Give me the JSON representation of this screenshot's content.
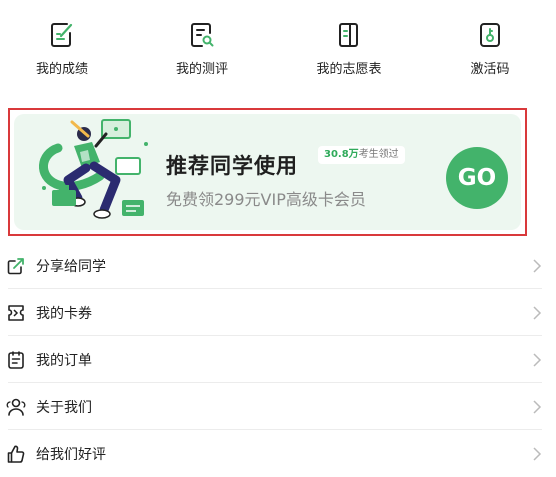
{
  "quick_links": [
    {
      "label": "我的成绩",
      "icon": "report-edit-icon"
    },
    {
      "label": "我的测评",
      "icon": "evaluation-search-icon"
    },
    {
      "label": "我的志愿表",
      "icon": "volunteer-form-icon"
    },
    {
      "label": "激活码",
      "icon": "activation-code-icon"
    }
  ],
  "banner": {
    "title": "推荐同学使用",
    "badge_count": "30.8万",
    "badge_suffix": "考生领过",
    "subtitle": "免费领299元VIP高级卡会员",
    "go_label": "GO"
  },
  "menu": [
    {
      "label": "分享给同学",
      "icon": "share-icon"
    },
    {
      "label": "我的卡券",
      "icon": "coupon-icon"
    },
    {
      "label": "我的订单",
      "icon": "order-icon"
    },
    {
      "label": "关于我们",
      "icon": "about-us-icon"
    },
    {
      "label": "给我们好评",
      "icon": "thumbs-up-icon"
    }
  ],
  "colors": {
    "accent": "#43b36b",
    "banner_bg": "#edf7f0",
    "highlight_border": "#d9393b",
    "text": "#222222",
    "subtext": "#8a8a8a"
  }
}
